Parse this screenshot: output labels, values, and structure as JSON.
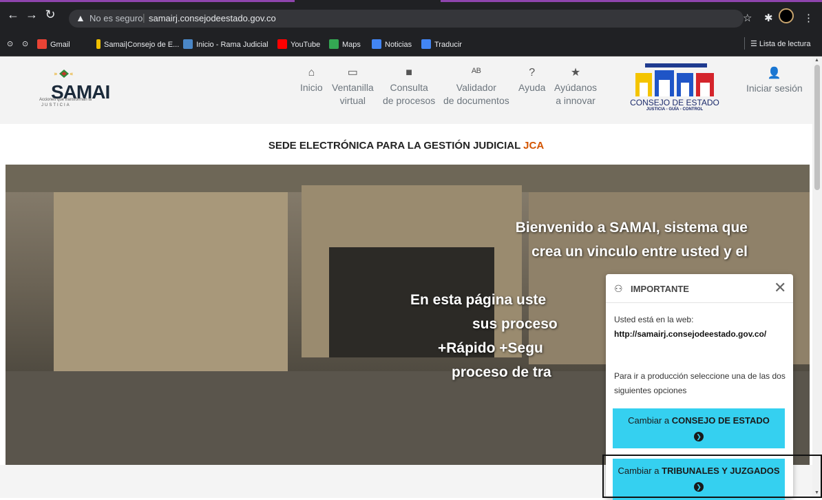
{
  "browser": {
    "security_label": "No es seguro",
    "url": "samairj.consejodeestado.gov.co",
    "bookmarks": [
      {
        "label": "Gmail",
        "color": "#ea4335"
      },
      {
        "label": "Samai|Consejo de E...",
        "color": "#f0c000"
      },
      {
        "label": "Inicio - Rama Judicial",
        "color": "#4a86c6"
      },
      {
        "label": "YouTube",
        "color": "#ff0000"
      },
      {
        "label": "Maps",
        "color": "#34a853"
      },
      {
        "label": "Noticias",
        "color": "#4285f4"
      },
      {
        "label": "Traducir",
        "color": "#4285f4"
      }
    ],
    "reading_list": "Lista de lectura"
  },
  "header": {
    "logo_title": "SAMAI",
    "logo_tagline": "Acciones que transforman la",
    "logo_justicia": "JUSTICIA",
    "nav": [
      {
        "label1": "Inicio",
        "label2": "",
        "icon": "home-icon"
      },
      {
        "label1": "Ventanilla",
        "label2": "virtual",
        "icon": "monitor-icon"
      },
      {
        "label1": "Consulta",
        "label2": "de procesos",
        "icon": "folder-icon"
      },
      {
        "label1": "Validador",
        "label2": "de documentos",
        "icon": "spellcheck-icon"
      },
      {
        "label1": "Ayuda",
        "label2": "",
        "icon": "question-icon"
      },
      {
        "label1": "Ayúdanos",
        "label2": "a innovar",
        "icon": "star-icon"
      }
    ],
    "ce_name": "CONSEJO DE ESTADO",
    "ce_tag": "JUSTICIA - GUÍA - CONTROL",
    "login": "Iniciar sesión"
  },
  "main": {
    "sede_title": "SEDE ELECTRÓNICA PARA LA GESTIÓN JUDICIAL",
    "sede_accent": "JCA",
    "hero_lines": [
      "Bienvenido a SAMAI, sistema que",
      "crea un vinculo entre usted y el",
      "",
      "En esta página uste",
      "sus proceso",
      "+Rápido +Segu",
      "proceso de tra"
    ]
  },
  "popup": {
    "title": "IMPORTANTE",
    "p1": "Usted está en la web:",
    "url": "http://samairj.consejodeestado.gov.co/",
    "p2": "Para ir a producción seleccione una de las dos siguientes opciones",
    "btn1_prefix": "Cambiar a",
    "btn1_bold": "CONSEJO DE ESTADO",
    "btn2_prefix": "Cambiar a",
    "btn2_bold": "TRIBUNALES Y JUZGADOS"
  },
  "colors": {
    "accent": "#d35400",
    "button": "#35d0f0",
    "chrome": "#202124"
  }
}
